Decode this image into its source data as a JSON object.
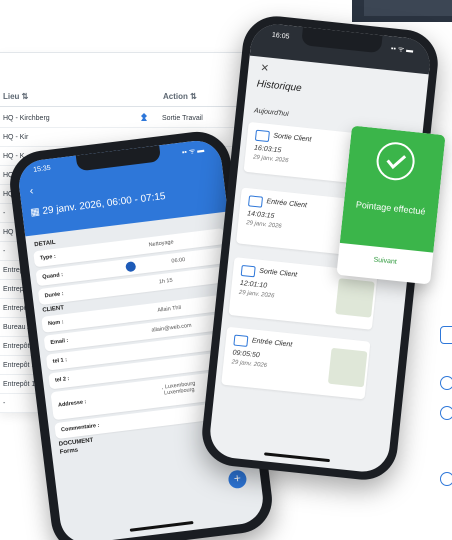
{
  "table": {
    "headers": [
      "Lieu ⇅",
      "Action ⇅"
    ],
    "first_action": "Sortie Travail",
    "locations": [
      "HQ - Kirchberg",
      "HQ - Kir",
      "HQ - K",
      "HQ - K",
      "HQ - K",
      "-",
      "HQ - Ki",
      "-",
      "Entrepôt",
      "Entrepôt",
      "Entrepôt 1",
      "Bureau Ann",
      "Entrepôt 1 - S",
      "Entrepôt 1 - S",
      "Entrepôt 1 - S",
      "-"
    ]
  },
  "phone_detail": {
    "time": "15:35",
    "status": "▪▪ ᯤ ▬",
    "back": "‹",
    "title": "29 janv. 2026, 06:00 - 07:15",
    "sections": {
      "detail": "DETAIL",
      "client": "CLIENT",
      "document": "DOCUMENT"
    },
    "fields": {
      "type_label": "Type :",
      "type_value": "Nettoyage",
      "quand_label": "Quand :",
      "quand_value": "06:00",
      "duree_label": "Durée :",
      "duree_value": "1h 15",
      "nom_label": "Nom :",
      "nom_value": "Allain Thil",
      "email_label": "Email :",
      "email_value": "allain@web.com",
      "tel1_label": "tel 1 :",
      "tel2_label": "tel 2 :",
      "adresse_label": "Addresse :",
      "adresse_value": ", Luxembourg\nLuxembourg",
      "comment_label": "Commentaire :",
      "forms_label": "Forms",
      "fab": "+"
    }
  },
  "phone_history": {
    "time": "16:05",
    "status": "▪▪ ᯤ ▬",
    "close": "✕",
    "title": "Historique",
    "today": "Aujourd'hui",
    "entries": [
      {
        "label": "Sortie Client",
        "time": "16:03:15",
        "date": "29 janv. 2026"
      },
      {
        "label": "Entrée Client",
        "time": "14:03:15",
        "date": "29 janv. 2026"
      },
      {
        "label": "Sortie Client",
        "time": "12:01:10",
        "date": "29 janv. 2026"
      },
      {
        "label": "Entrée Client",
        "time": "09:05:50",
        "date": "29 janv. 2026"
      }
    ]
  },
  "popup": {
    "message": "Pointage effectué",
    "button": "Suivant"
  },
  "colors": {
    "primary": "#2e77d9",
    "success": "#3bb54a"
  }
}
